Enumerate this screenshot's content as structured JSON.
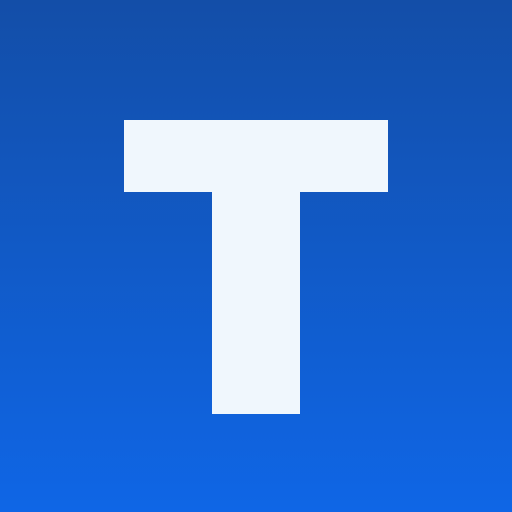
{
  "icon": {
    "semantic_name": "letter-t-logo",
    "glyph": "T",
    "colors": {
      "background_top": "#134ea8",
      "background_bottom": "#0f66e6",
      "glyph": "#f0f7fd"
    }
  }
}
